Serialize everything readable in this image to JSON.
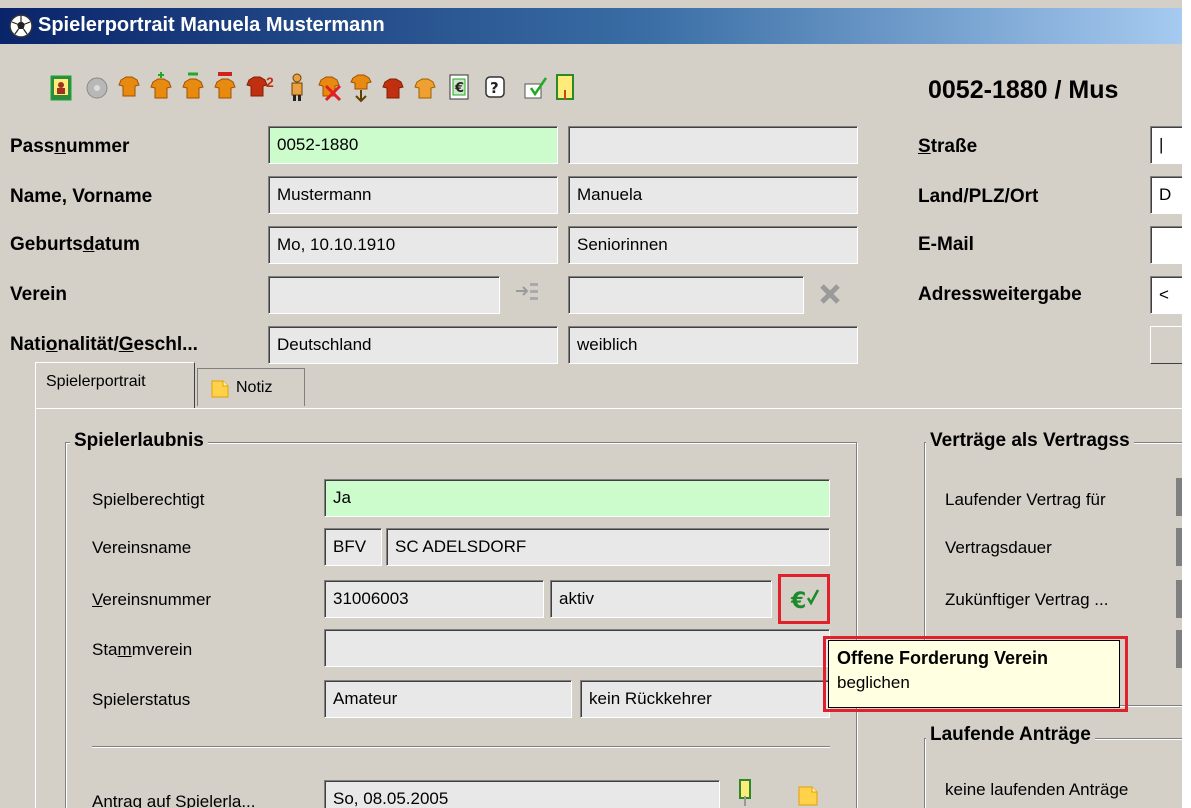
{
  "window": {
    "title": "Spielerportrait Manuela Mustermann"
  },
  "toolbar": {
    "icons": [
      "player-photo-icon",
      "disc-icon",
      "shirt-icon",
      "shirt-add-icon",
      "shirt-green-icon",
      "shirt-red-icon",
      "shirt-2-icon",
      "person-icon",
      "shirt-delete-icon",
      "transfer-icon",
      "shirt-small-icon",
      "shirt-orange-icon",
      "euro-doc-icon",
      "help-icon",
      "checklist-icon",
      "document-icon"
    ],
    "shirt_2_label": "2"
  },
  "header": {
    "id_title": "0052-1880 / Mus"
  },
  "form": {
    "passnummer": {
      "label_pre": "Pass",
      "label_u": "n",
      "label_post": "ummer",
      "value": "0052-1880",
      "value2": ""
    },
    "name": {
      "label": "Name, Vorname",
      "last": "Mustermann",
      "first": "Manuela"
    },
    "geburtsdatum": {
      "label_pre": "Geburts",
      "label_u": "d",
      "label_post": "atum",
      "value": "Mo, 10.10.1910",
      "class": "Seniorinnen"
    },
    "verein": {
      "label": "Verein",
      "value": "",
      "value2": ""
    },
    "nationalitaet": {
      "label_pre": "Nati",
      "label_u": "o",
      "label_mid": "nalität/",
      "label_u2": "G",
      "label_post": "eschl...",
      "value": "Deutschland",
      "gender": "weiblich"
    }
  },
  "address": {
    "strasse": {
      "label_u": "S",
      "label_post": "traße",
      "value": "|"
    },
    "land": {
      "label": "Land/PLZ/Ort",
      "value": "D"
    },
    "email": {
      "label": "E-Mail",
      "value": ""
    },
    "weitergabe": {
      "label": "Adressweitergabe",
      "value": "<"
    }
  },
  "tabs": [
    {
      "label": "Spielerportrait"
    },
    {
      "label": "Notiz"
    }
  ],
  "spielerlaubnis": {
    "title": "Spielerlaubnis",
    "spielberechtigt": {
      "label": "Spielberechtigt",
      "value": "Ja"
    },
    "vereinsname": {
      "label": "Vereinsname",
      "verband": "BFV",
      "value": "SC ADELSDORF"
    },
    "vereinsnummer": {
      "label_u": "V",
      "label_post": "ereinsnummer",
      "value": "31006003",
      "status": "aktiv"
    },
    "stammverein": {
      "label_pre": "Sta",
      "label_u": "m",
      "label_post": "mverein",
      "value": ""
    },
    "spielerstatus": {
      "label": "Spielerstatus",
      "value": "Amateur",
      "value2": "kein Rückkehrer"
    },
    "antrag": {
      "label": "Antrag auf Spielerla...",
      "value": "So, 08.05.2005"
    }
  },
  "vertraege": {
    "title": "Verträge als Vertragss",
    "laufend": "Laufender Vertrag für",
    "dauer": "Vertragsdauer",
    "zukunft": "Zukünftiger Vertrag ..."
  },
  "antraege": {
    "title": "Laufende Anträge",
    "none": "keine laufenden Anträge"
  },
  "tooltip": {
    "title": "Offene Forderung Verein",
    "text": "beglichen"
  },
  "colors": {
    "highlight_red": "#e0202a",
    "field_green": "#ccfccc",
    "tooltip_bg": "#ffffe1",
    "title_blue": "#0a246a"
  }
}
